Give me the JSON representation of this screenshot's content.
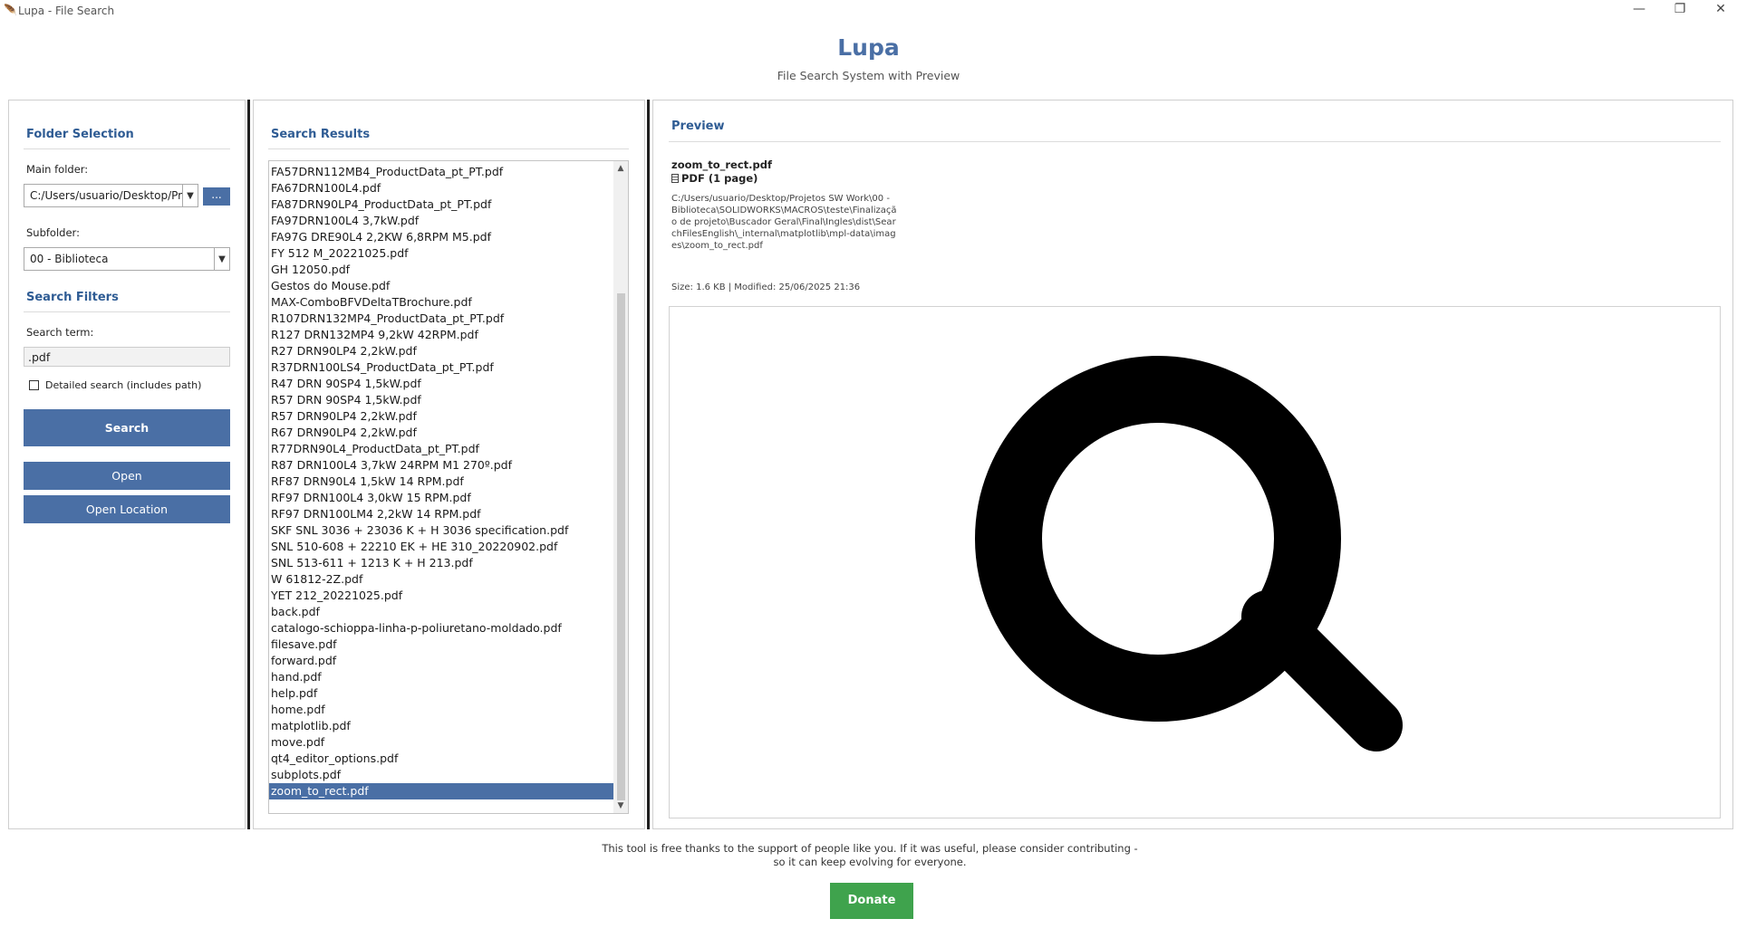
{
  "window": {
    "title": "Lupa - File Search",
    "minimize_glyph": "—",
    "restore_glyph": "❐",
    "close_glyph": "✕"
  },
  "header": {
    "title": "Lupa",
    "subtitle": "File Search System with Preview"
  },
  "left": {
    "folder_title": "Folder Selection",
    "main_folder_label": "Main folder:",
    "main_folder_value": "C:/Users/usuario/Desktop/Proj",
    "browse_label": "...",
    "subfolder_label": "Subfolder:",
    "subfolder_value": "00 - Biblioteca",
    "filters_title": "Search Filters",
    "search_term_label": "Search term:",
    "search_term_value": ".pdf",
    "detailed_label": "Detailed search (includes path)",
    "detailed_checked": false,
    "search_button": "Search",
    "open_button": "Open",
    "open_location_button": "Open Location"
  },
  "results": {
    "title": "Search Results",
    "selected": "zoom_to_rect.pdf",
    "items": [
      "FA57DRN112MB4_ProductData_pt_PT.pdf",
      "FA67DRN100L4.pdf",
      "FA87DRN90LP4_ProductData_pt_PT.pdf",
      "FA97DRN100L4 3,7kW.pdf",
      "FA97G DRE90L4 2,2KW 6,8RPM M5.pdf",
      "FY 512 M_20221025.pdf",
      "GH 12050.pdf",
      "Gestos do Mouse.pdf",
      "MAX-ComboBFVDeltaTBrochure.pdf",
      "R107DRN132MP4_ProductData_pt_PT.pdf",
      "R127 DRN132MP4 9,2kW 42RPM.pdf",
      "R27 DRN90LP4 2,2kW.pdf",
      "R37DRN100LS4_ProductData_pt_PT.pdf",
      "R47 DRN 90SP4 1,5kW.pdf",
      "R57 DRN 90SP4 1,5kW.pdf",
      "R57 DRN90LP4 2,2kW.pdf",
      "R67 DRN90LP4 2,2kW.pdf",
      "R77DRN90L4_ProductData_pt_PT.pdf",
      "R87 DRN100L4 3,7kW 24RPM M1 270º.pdf",
      "RF87 DRN90L4 1,5kW 14 RPM.pdf",
      "RF97 DRN100L4 3,0kW 15 RPM.pdf",
      "RF97 DRN100LM4 2,2kW 14 RPM.pdf",
      "SKF SNL 3036 + 23036 K + H 3036 specification.pdf",
      "SNL 510-608 + 22210 EK + HE 310_20220902.pdf",
      "SNL 513-611 + 1213 K + H 213.pdf",
      "W 61812-2Z.pdf",
      "YET 212_20221025.pdf",
      "back.pdf",
      "catalogo-schioppa-linha-p-poliuretano-moldado.pdf",
      "filesave.pdf",
      "forward.pdf",
      "hand.pdf",
      "help.pdf",
      "home.pdf",
      "matplotlib.pdf",
      "move.pdf",
      "qt4_editor_options.pdf",
      "subplots.pdf",
      "zoom_to_rect.pdf"
    ]
  },
  "preview": {
    "title": "Preview",
    "file_name": "zoom_to_rect.pdf",
    "file_type": "PDF (1 page)",
    "path": "C:/Users/usuario/Desktop/Projetos SW Work\\00 - Biblioteca\\SOLIDWORKS\\MACROS\\teste\\Finalização de projeto\\Buscador Geral\\Final\\Ingles\\dist\\SearchFilesEnglish\\_internal\\matplotlib\\mpl-data\\images\\zoom_to_rect.pdf",
    "size_info": "Size: 1.6 KB | Modified: 25/06/2025 21:36",
    "image_icon": "magnifying-glass"
  },
  "footer": {
    "message": "This tool is free thanks to the support of people like you. If it was useful, please consider contributing - so it can keep evolving for everyone.",
    "donate_button": "Donate"
  },
  "colors": {
    "accent": "#4a6fa5",
    "section_title": "#2f5c94",
    "donate": "#3fa34d"
  }
}
